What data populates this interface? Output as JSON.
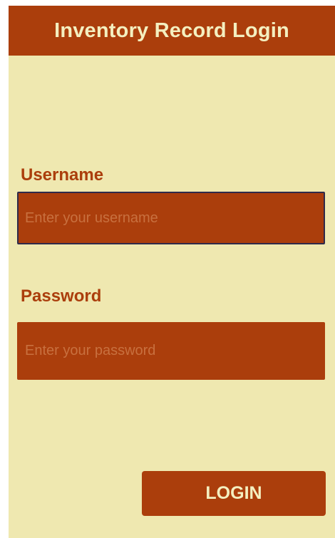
{
  "header": {
    "title": "Inventory Record Login"
  },
  "form": {
    "username_label": "Username",
    "username_placeholder": "Enter your username",
    "password_label": "Password",
    "password_placeholder": "Enter your password",
    "login_label": "LOGIN"
  },
  "colors": {
    "background": "#efe8b0",
    "accent": "#ab3e0c",
    "accent_text": "#f4efc0"
  }
}
